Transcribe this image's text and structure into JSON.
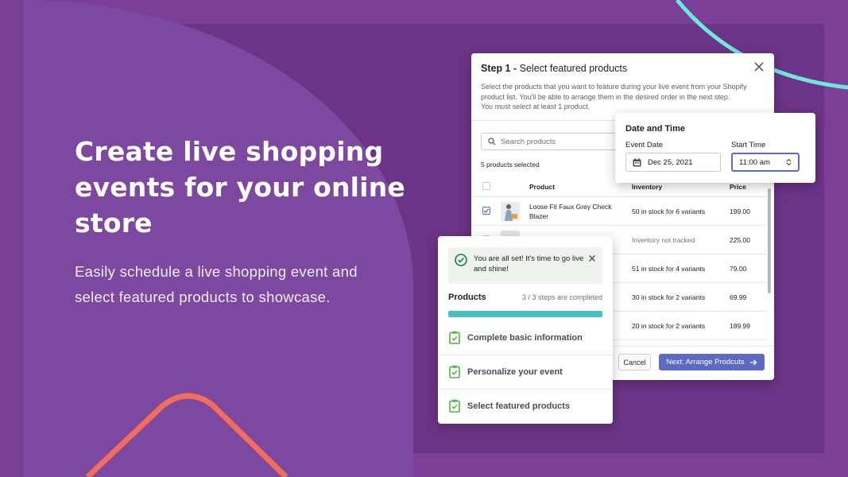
{
  "hero": {
    "title": "Create live shopping events for your online store",
    "subtitle": "Easily schedule a live shopping event and select featured products to showcase."
  },
  "colors": {
    "background": "#7b3f98",
    "accent_teal": "#47c1bf",
    "accent_orange": "#f26d5b",
    "primary_button": "#5c6ac4"
  },
  "modal": {
    "step_prefix": "Step 1 -",
    "title": "Select featured products",
    "description_line1": "Select the products that you want to feature during your live event from your Shopify product list. You'll be able to arrange them in the desired order in the next step.",
    "description_line2": "You must select at least 1 product.",
    "search_placeholder": "Search products",
    "selected_count": "5 products selected",
    "columns": {
      "product": "Product",
      "inventory": "Inventory",
      "price": "Price"
    },
    "rows": [
      {
        "product": "Loose Fit Faux Grey Check Blazer",
        "inventory": "50 in stock for 6 variants",
        "price": "199.00",
        "checked": true
      },
      {
        "product": "",
        "inventory": "Inventory not tracked",
        "price": "225.00",
        "checked": false
      },
      {
        "product": "",
        "inventory": "51 in stock for 4 variants",
        "price": "79.00",
        "checked": false
      },
      {
        "product": "",
        "inventory": "30 in stock for 2 variants",
        "price": "69.99",
        "checked": false
      },
      {
        "product": "",
        "inventory": "20 in stock for 2 variants",
        "price": "189.99",
        "checked": false
      }
    ],
    "cancel_label": "Cancel",
    "next_label": "Next: Arrange Prodcuts"
  },
  "datetime": {
    "title": "Date and Time",
    "event_date_label": "Event Date",
    "event_date_value": "Dec 25, 2021",
    "start_time_label": "Start Time",
    "start_time_value": "11:00 am"
  },
  "progress": {
    "banner_text": "You are all set! It's time to go live and shine!",
    "title": "Products",
    "steps_text": "3 / 3 steps are completed",
    "percent_complete": 100,
    "steps": [
      {
        "label": "Complete basic information"
      },
      {
        "label": "Personalize your event"
      },
      {
        "label": "Select featured products"
      }
    ]
  }
}
